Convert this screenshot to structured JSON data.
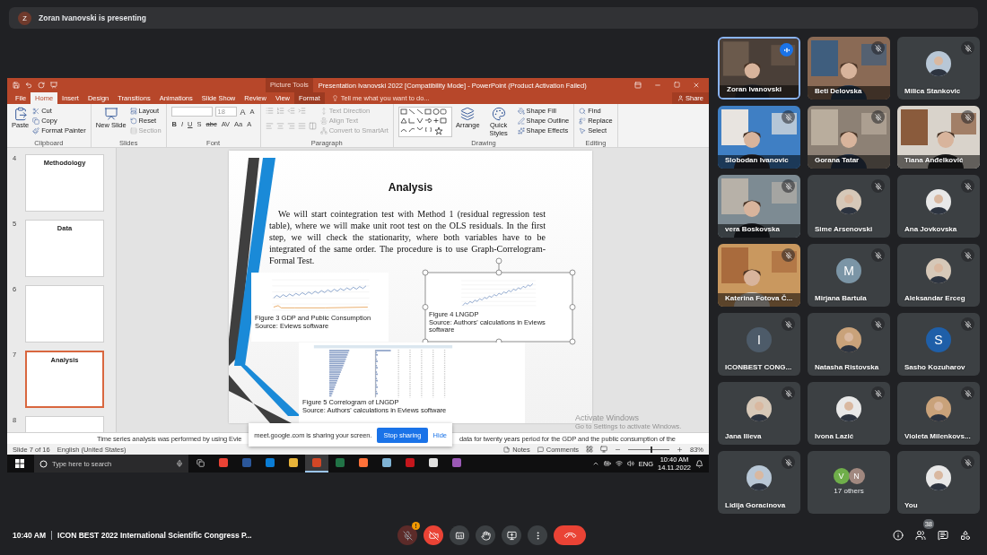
{
  "presenting_banner": {
    "avatar_letter": "Z",
    "text": "Zoran Ivanovski is presenting"
  },
  "powerpoint": {
    "contextual_label": "Picture Tools",
    "title": "Presentation Ivanovski 2022 [Compatibility Mode] - PowerPoint (Product Activation Failed)",
    "tabs": [
      {
        "label": "File",
        "selected": false,
        "contextual": false
      },
      {
        "label": "Home",
        "selected": true,
        "contextual": false
      },
      {
        "label": "Insert",
        "selected": false,
        "contextual": false
      },
      {
        "label": "Design",
        "selected": false,
        "contextual": false
      },
      {
        "label": "Transitions",
        "selected": false,
        "contextual": false
      },
      {
        "label": "Animations",
        "selected": false,
        "contextual": false
      },
      {
        "label": "Slide Show",
        "selected": false,
        "contextual": false
      },
      {
        "label": "Review",
        "selected": false,
        "contextual": false
      },
      {
        "label": "View",
        "selected": false,
        "contextual": false
      },
      {
        "label": "Format",
        "selected": false,
        "contextual": true
      }
    ],
    "tell_me": "Tell me what you want to do...",
    "share": "Share",
    "ribbon_groups": [
      {
        "name": "Clipboard",
        "items": [
          {
            "kind": "large",
            "label": "Paste"
          },
          {
            "kind": "stack",
            "items": [
              {
                "label": "Cut",
                "disabled": false
              },
              {
                "label": "Copy",
                "disabled": false
              },
              {
                "label": "Format Painter",
                "disabled": false
              }
            ]
          }
        ]
      },
      {
        "name": "Slides",
        "items": [
          {
            "kind": "large",
            "label": "New Slide"
          },
          {
            "kind": "stack",
            "items": [
              {
                "label": "Layout",
                "disabled": false
              },
              {
                "label": "Reset",
                "disabled": false
              },
              {
                "label": "Section",
                "disabled": true
              }
            ]
          }
        ]
      },
      {
        "name": "Font",
        "items": [
          {
            "kind": "font",
            "size": "18",
            "size_buttons": [
              "A",
              "A"
            ],
            "format_buttons": [
              "B",
              "I",
              "U",
              "S",
              "abc",
              "AV",
              "Aa",
              "A"
            ]
          }
        ]
      },
      {
        "name": "Paragraph",
        "items": [
          {
            "kind": "paragraph_icons"
          },
          {
            "kind": "stack",
            "items": [
              {
                "label": "Text Direction",
                "disabled": true
              },
              {
                "label": "Align Text",
                "disabled": true
              },
              {
                "label": "Convert to SmartArt",
                "disabled": true
              }
            ]
          }
        ]
      },
      {
        "name": "Drawing",
        "items": [
          {
            "kind": "shapes"
          },
          {
            "kind": "large",
            "label": "Arrange"
          },
          {
            "kind": "large",
            "label": "Quick Styles"
          },
          {
            "kind": "stack",
            "items": [
              {
                "label": "Shape Fill",
                "disabled": false
              },
              {
                "label": "Shape Outline",
                "disabled": false
              },
              {
                "label": "Shape Effects",
                "disabled": false
              }
            ]
          }
        ]
      },
      {
        "name": "Editing",
        "items": [
          {
            "kind": "stack",
            "items": [
              {
                "label": "Find",
                "disabled": false
              },
              {
                "label": "Replace",
                "disabled": false
              },
              {
                "label": "Select",
                "disabled": false
              }
            ]
          }
        ]
      }
    ],
    "thumbnails": [
      {
        "number": "4",
        "title": "Methodology",
        "selected": false
      },
      {
        "number": "5",
        "title": "Data",
        "selected": false
      },
      {
        "number": "6",
        "selected": false
      },
      {
        "number": "7",
        "title": "Analysis",
        "selected": true
      },
      {
        "number": "8",
        "selected": false
      }
    ],
    "slide": {
      "title": "Analysis",
      "body": "We will start cointegration test with Method 1 (residual regression test table), where we will make unit root test on the OLS residuals. In the first step, we will check the stationarity, where both variables have to be integrated of the same order. The procedure is to use Graph-Correlogram-Formal Test.",
      "figures": [
        {
          "kind": "lines",
          "caption": "Figure 3 GDP and Public Consumption",
          "source": "Source: Eviews software",
          "selected": false
        },
        {
          "kind": "line",
          "caption": "Figure 4 LNGDP",
          "source": "Source: Authors' calculations in Eviews software",
          "selected": true
        },
        {
          "kind": "correlogram",
          "caption": "Figure 5 Correlogram of LNGDP",
          "source": "Source: Authors' calculations in Eviews software",
          "selected": false
        }
      ]
    },
    "notes_left": "Time series analysis was performed by using Evie",
    "notes_right": "data for twenty years period for the GDP and the public consumption of the",
    "share_banner": {
      "text": "meet.google.com is sharing your screen.",
      "stop": "Stop sharing",
      "hide": "Hide"
    },
    "activation": {
      "title": "Activate Windows",
      "hint": "Go to Settings to activate Windows."
    },
    "status": {
      "slide_info": "Slide 7 of 16",
      "language": "English (United States)",
      "notes": "Notes",
      "comments": "Comments",
      "zoom": "83%",
      "level": 0.55
    },
    "taskbar": {
      "search_placeholder": "Type here to search",
      "apps": [
        {
          "active": false
        },
        {
          "active": false
        },
        {
          "active": false
        },
        {
          "active": false
        },
        {
          "active": true
        },
        {
          "active": false
        },
        {
          "active": false
        },
        {
          "active": false
        },
        {
          "active": false
        },
        {
          "active": false
        },
        {
          "active": false
        }
      ],
      "language": "ENG",
      "time": "10:40 AM",
      "date": "14.11.2022"
    }
  },
  "participants": [
    {
      "name": "Zoran Ivanovski",
      "kind": "video",
      "muted": false,
      "speaking": true
    },
    {
      "name": "Beti Delovska",
      "kind": "video",
      "muted": true,
      "speaking": false
    },
    {
      "name": "Milica Stankovic",
      "muted": true,
      "speaking": false
    },
    {
      "name": "Slobodan Ivanovic",
      "kind": "video",
      "muted": true,
      "speaking": false
    },
    {
      "name": "Gorana Tatar",
      "kind": "video",
      "muted": true,
      "speaking": false
    },
    {
      "name": "Tiana Anđelković",
      "kind": "video",
      "muted": true,
      "speaking": false
    },
    {
      "name": "vera Boskovska",
      "kind": "video",
      "muted": true,
      "speaking": false
    },
    {
      "name": "Sime Arsenovski",
      "muted": true,
      "speaking": false
    },
    {
      "name": "Ana Jovkovska",
      "muted": true,
      "speaking": false
    },
    {
      "name": "Katerina Fotova Č...",
      "kind": "video",
      "muted": true,
      "speaking": false
    },
    {
      "name": "Mirjana Bartula",
      "kind": "letter",
      "letter": "M",
      "color": "#7b95a6",
      "muted": true,
      "speaking": false
    },
    {
      "name": "Aleksandar Erceg",
      "muted": true,
      "speaking": false
    },
    {
      "name": "ICONBEST CONG...",
      "kind": "letter",
      "letter": "I",
      "color": "#4d5b69",
      "muted": true,
      "speaking": false
    },
    {
      "name": "Natasha Ristovska",
      "muted": true,
      "speaking": false
    },
    {
      "name": "Sasho Kozuharov",
      "kind": "letter",
      "letter": "S",
      "color": "#1f5fa8",
      "muted": true,
      "speaking": false
    },
    {
      "name": "Jana Ilieva",
      "muted": true,
      "speaking": false
    },
    {
      "name": "Ivona Lazić",
      "muted": true,
      "speaking": false
    },
    {
      "name": "Violeta Milenkovs...",
      "muted": true,
      "speaking": false
    },
    {
      "name": "Lidija Goracinova",
      "muted": true,
      "speaking": false
    },
    {
      "name": "17 others",
      "kind": "others",
      "avatars": [
        {
          "letter": "V",
          "color": "#6fae4a"
        },
        {
          "letter": "N",
          "color": "#a1887f"
        }
      ],
      "muted": false,
      "speaking": false
    },
    {
      "name": "You",
      "muted": true,
      "speaking": false
    }
  ],
  "meet_bar": {
    "time": "10:40 AM",
    "meeting_title": "ICON BEST 2022 International Scientific Congress P...",
    "mic_on": false,
    "mic_alert": "!",
    "camera_on": false,
    "people_count": "38"
  }
}
